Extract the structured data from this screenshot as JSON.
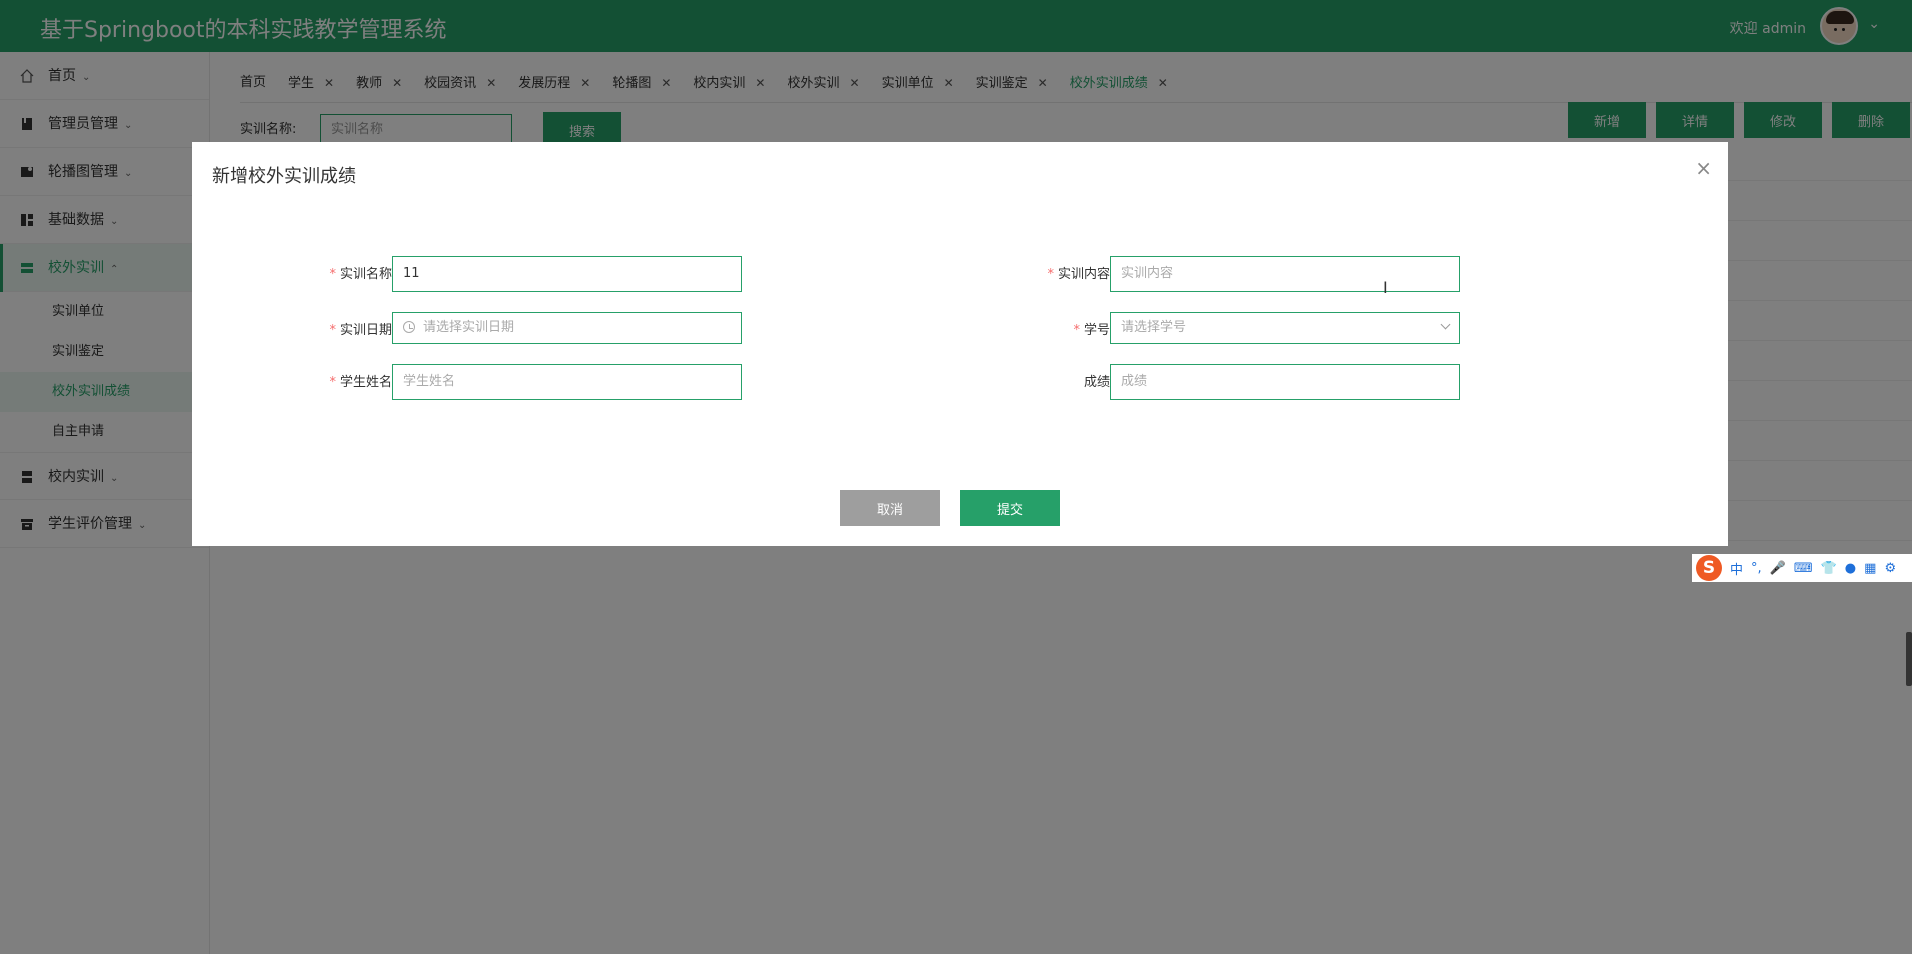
{
  "app": {
    "title": "基于Springboot的本科实践教学管理系统",
    "welcome": "欢迎 admin"
  },
  "sidebar": {
    "items": [
      {
        "label": "首页",
        "arrow": "⌄"
      },
      {
        "label": "管理员管理",
        "arrow": "⌄"
      },
      {
        "label": "轮播图管理",
        "arrow": "⌄"
      },
      {
        "label": "基础数据",
        "arrow": "⌄"
      },
      {
        "label": "校外实训",
        "arrow": "⌃"
      },
      {
        "label": "校内实训",
        "arrow": "⌄"
      },
      {
        "label": "学生评价管理",
        "arrow": "⌄"
      }
    ],
    "subitems": [
      "实训单位",
      "实训鉴定",
      "校外实训成绩",
      "自主申请"
    ]
  },
  "tabs": [
    "首页",
    "学生",
    "教师",
    "校园资讯",
    "发展历程",
    "轮播图",
    "校内实训",
    "校外实训",
    "实训单位",
    "实训鉴定",
    "校外实训成绩"
  ],
  "toolbar": {
    "search_label": "实训名称:",
    "search_placeholder": "实训名称",
    "search_button": "搜索",
    "add": "新增",
    "detail": "详情",
    "edit": "修改",
    "delete": "删除"
  },
  "dialog": {
    "title": "新增校外实训成绩",
    "close": "×",
    "fields": {
      "name_label": "实训名称",
      "name_value": "11",
      "content_label": "实训内容",
      "content_placeholder": "实训内容",
      "date_label": "实训日期",
      "date_placeholder": "请选择实训日期",
      "student_no_label": "学号",
      "student_no_placeholder": "请选择学号",
      "student_name_label": "学生姓名",
      "student_name_placeholder": "学生姓名",
      "score_label": "成绩",
      "score_placeholder": "成绩"
    },
    "cancel": "取消",
    "submit": "提交"
  },
  "ime": {
    "logo": "S",
    "mode": "中",
    "punct": "°,"
  },
  "colors": {
    "primary": "#26a069",
    "cancel": "#9e9e9e",
    "required": "#f56c6c"
  }
}
